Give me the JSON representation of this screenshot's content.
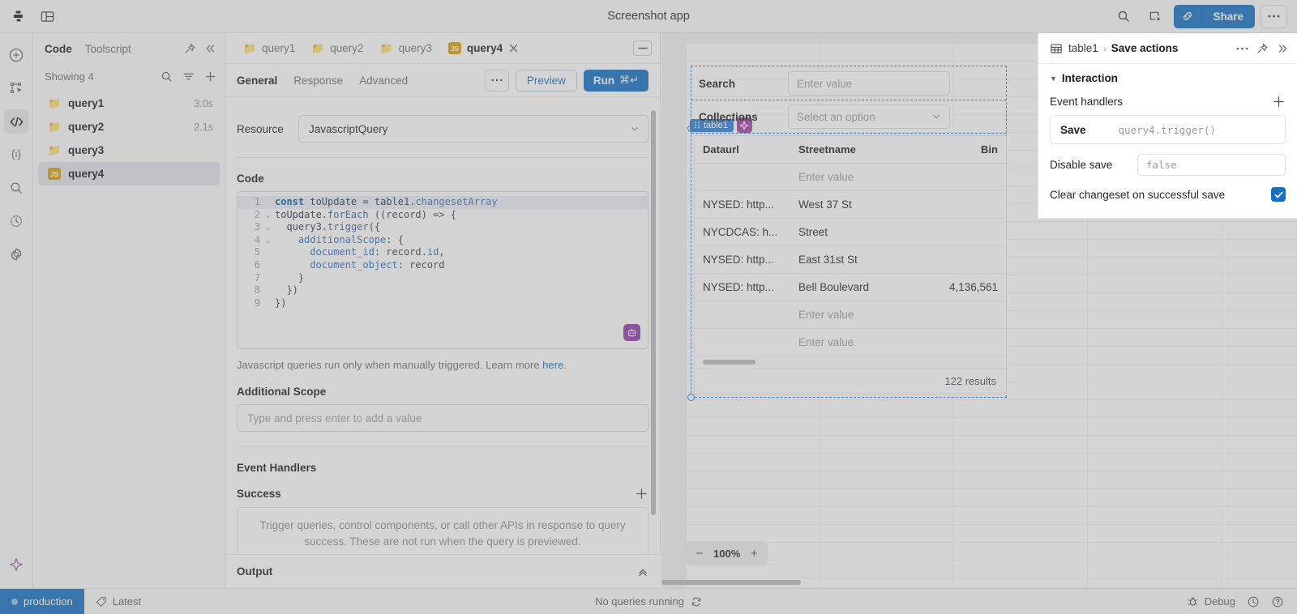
{
  "topbar": {
    "app_title": "Screenshot app",
    "left_icons": [
      "app-logo-icon",
      "layout-panel-icon"
    ],
    "search_label": "search-icon",
    "deploy_label": "deploy-icon",
    "link_label": "link-icon",
    "share_label": "Share",
    "more_label": "•••"
  },
  "rail": {
    "items": [
      {
        "name": "add-component",
        "icon": "plus-circle-icon"
      },
      {
        "name": "component-tree",
        "icon": "component-select-icon"
      },
      {
        "name": "code",
        "icon": "code-brackets-icon",
        "active": true
      },
      {
        "name": "state",
        "icon": "state-braces-icon"
      },
      {
        "name": "search",
        "icon": "search-icon"
      },
      {
        "name": "history",
        "icon": "clock-history-icon"
      },
      {
        "name": "settings",
        "icon": "gear-icon"
      }
    ],
    "bottom_icon": "ai-sparkle-icon"
  },
  "queries_panel": {
    "tabs": [
      {
        "label": "Code",
        "active": true
      },
      {
        "label": "Toolscript",
        "active": false
      }
    ],
    "pin_icon": "pin-icon",
    "collapse_icon": "chevrons-left-icon",
    "showing_label": "Showing 4",
    "actions": [
      "search-icon",
      "filter-icon",
      "plus-icon"
    ],
    "items": [
      {
        "name": "query1",
        "icon": "folder-emoji",
        "duration": "3.0s",
        "selected": false
      },
      {
        "name": "query2",
        "icon": "folder-emoji",
        "duration": "2.1s",
        "selected": false
      },
      {
        "name": "query3",
        "icon": "folder-emoji",
        "duration": "",
        "selected": false
      },
      {
        "name": "query4",
        "icon": "js-badge",
        "duration": "",
        "selected": true
      }
    ]
  },
  "editor": {
    "open_tabs": [
      {
        "label": "query1",
        "icon": "folder-emoji",
        "active": false
      },
      {
        "label": "query2",
        "icon": "folder-emoji",
        "active": false
      },
      {
        "label": "query3",
        "icon": "folder-emoji",
        "active": false
      },
      {
        "label": "query4",
        "icon": "js-badge",
        "active": true,
        "closable": true
      }
    ],
    "collapse_icon": "collapse-panel-icon",
    "subtabs": [
      {
        "label": "General",
        "active": true
      },
      {
        "label": "Response",
        "active": false
      },
      {
        "label": "Advanced",
        "active": false
      }
    ],
    "more_label": "•••",
    "preview_label": "Preview",
    "run_label": "Run",
    "run_shortcut": "⌘↵",
    "resource_label": "Resource",
    "resource_value": "JavascriptQuery",
    "code_label": "Code",
    "code_lines": [
      {
        "n": "1",
        "fold": "",
        "html": "<span class=\"tk-kw\">const</span> <span class=\"tk-var\">toUpdate</span> <span class=\"tk-pl\">=</span> <span class=\"tk-var\">table1</span><span class=\"tk-pl\">.</span><span class=\"tk-prop\">changesetArray</span>",
        "highlight": true
      },
      {
        "n": "2",
        "fold": "v",
        "html": "<span class=\"tk-var\">toUpdate</span><span class=\"tk-pl\">.</span><span class=\"tk-fn\">forEach</span> <span class=\"tk-pl\">((record) =&gt; {</span>"
      },
      {
        "n": "3",
        "fold": "v",
        "html": "  <span class=\"tk-var\">query3</span><span class=\"tk-pl\">.</span><span class=\"tk-fn\">trigger</span><span class=\"tk-pl\">({</span>"
      },
      {
        "n": "4",
        "fold": "v",
        "html": "    <span class=\"tk-key\">additionalScope</span><span class=\"tk-pl\">: {</span>"
      },
      {
        "n": "5",
        "fold": "",
        "html": "      <span class=\"tk-key\">document_id</span><span class=\"tk-pl\">: record</span><span class=\"tk-pl\">.</span><span class=\"tk-prop\">id</span><span class=\"tk-pl\">,</span>"
      },
      {
        "n": "6",
        "fold": "",
        "html": "      <span class=\"tk-key\">document_object</span><span class=\"tk-pl\">: record</span>"
      },
      {
        "n": "7",
        "fold": "",
        "html": "    <span class=\"tk-pl\">}</span>"
      },
      {
        "n": "8",
        "fold": "",
        "html": "  <span class=\"tk-pl\">})</span>"
      },
      {
        "n": "9",
        "fold": "",
        "html": "<span class=\"tk-pl\">})</span>"
      }
    ],
    "ai_chip_icon": "ai-robot-icon",
    "helper_text_1": "Javascript queries run only when manually triggered. Learn more ",
    "helper_link": "here",
    "helper_text_2": ".",
    "additional_scope_label": "Additional Scope",
    "additional_scope_placeholder": "Type and press enter to add a value",
    "event_handlers_label": "Event Handlers",
    "success_label": "Success",
    "success_placeholder": "Trigger queries, control components, or call other APIs in response to query success. These are not run when the query is previewed.",
    "output_label": "Output",
    "output_collapse_icon": "chevrons-up-icon"
  },
  "canvas": {
    "form": {
      "search_label": "Search",
      "search_placeholder": "Enter value",
      "collections_label": "Collections",
      "collections_placeholder": "Select an option"
    },
    "widget_tag": "table1",
    "widget_tag_ai_icon": "ai-sparkle-icon",
    "table": {
      "columns": [
        "Dataurl",
        "Streetname",
        "Bin"
      ],
      "rows": [
        {
          "dataurl": "",
          "streetname": "Enter value",
          "bin": "",
          "placeholder": true
        },
        {
          "dataurl": "NYSED: http...",
          "streetname": "West 37 St",
          "bin": ""
        },
        {
          "dataurl": "NYCDCAS: h...",
          "streetname": "Street",
          "bin": ""
        },
        {
          "dataurl": "NYSED: http...",
          "streetname": "East 31st St",
          "bin": ""
        },
        {
          "dataurl": "NYSED: http...",
          "streetname": "Bell Boulevard",
          "bin": "4,136,561"
        },
        {
          "dataurl": "",
          "streetname": "Enter value",
          "bin": "",
          "placeholder": true
        },
        {
          "dataurl": "",
          "streetname": "Enter value",
          "bin": "",
          "placeholder": true
        }
      ],
      "results_label": "122 results"
    },
    "zoom": {
      "minus": "−",
      "value": "100%",
      "plus": "+"
    }
  },
  "inspector": {
    "crumb_icon": "table-grid-icon",
    "crumb_parent": "table1",
    "crumb_sep": "›",
    "crumb_current": "Save actions",
    "actions": [
      "more-dots-icon",
      "pin-icon",
      "chevrons-right-icon"
    ],
    "section_title": "Interaction",
    "event_handlers_label": "Event handlers",
    "add_icon": "plus-icon",
    "handler_name": "Save",
    "handler_value": "query4.trigger()",
    "disable_save_label": "Disable save",
    "disable_save_value": "false",
    "clear_changeset_label": "Clear changeset on successful save",
    "clear_changeset_checked": true
  },
  "statusbar": {
    "env_label": "production",
    "version_label": "Latest",
    "version_icon": "tag-icon",
    "queries_status": "No queries running",
    "refresh_icon": "refresh-icon",
    "debug_label": "Debug",
    "debug_icon": "bug-icon",
    "history_icon": "clock-icon",
    "help_icon": "help-circle-icon"
  },
  "colors": {
    "accent": "#1570c4",
    "selection": "#2f7fd6",
    "ai": "#8e3fa8",
    "js_badge": "#d9a215"
  }
}
